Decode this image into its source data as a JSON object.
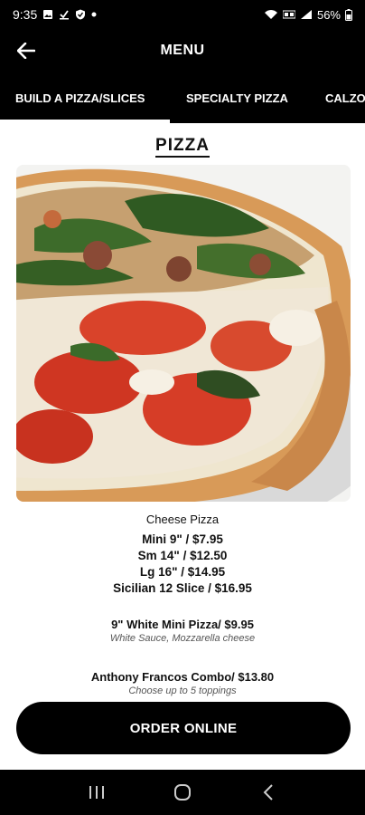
{
  "status_bar": {
    "time": "9:35",
    "battery": "56%",
    "icons_left": [
      "image-icon",
      "download-check-icon",
      "shield-icon",
      "dot-icon"
    ],
    "icons_right": [
      "wifi-icon",
      "volte-icon",
      "signal-icon",
      "battery-icon"
    ]
  },
  "header": {
    "title": "MENU",
    "back_icon": "arrow-left-icon"
  },
  "tabs": [
    {
      "label": "BUILD A PIZZA/SLICES",
      "active": true
    },
    {
      "label": "SPECIALTY PIZZA",
      "active": false
    },
    {
      "label": "CALZONES",
      "active": false
    }
  ],
  "section": {
    "title": "PIZZA"
  },
  "items": {
    "cheese": {
      "name": "Cheese Pizza",
      "prices": [
        "Mini 9\" / $7.95",
        "Sm 14\" / $12.50",
        "Lg 16\" / $14.95",
        "Sicilian 12 Slice / $16.95"
      ]
    },
    "white_mini": {
      "title": "9\" White Mini Pizza/ $9.95",
      "desc": "White Sauce, Mozzarella cheese"
    },
    "combo": {
      "title": "Anthony Francos Combo/ $13.80",
      "desc": "Choose up to 5 toppings"
    }
  },
  "order_button": {
    "label": "ORDER ONLINE"
  },
  "nav": {
    "recent_icon": "recent-apps-icon",
    "home_icon": "home-icon",
    "back_icon": "back-chevron-icon"
  },
  "colors": {
    "bar_bg": "#000000",
    "content_bg": "#ffffff",
    "text": "#111111"
  }
}
